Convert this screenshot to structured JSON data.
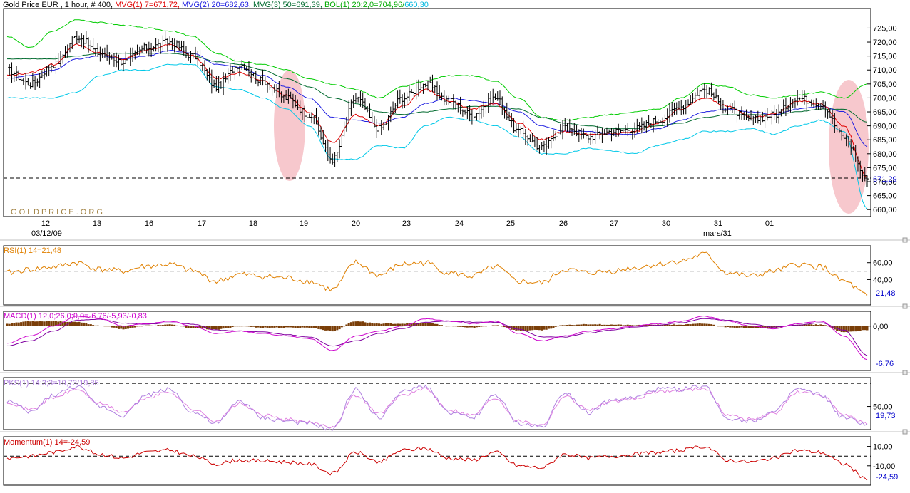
{
  "colors": {
    "frame": "#000000",
    "bar": "#000000",
    "mvg1": "#e00000",
    "mvg2": "#2020e0",
    "mvg3": "#006a2e",
    "bol_upper": "#00cc00",
    "bol_lower": "#00c8e8",
    "highlight": "#f4b0b8",
    "rsi": "#e08000",
    "macd_hist": "#7a3e08",
    "macd": "#cc00cc",
    "signal": "#8000a0",
    "stoch_k": "#b080e0",
    "stoch_d": "#e080e0",
    "momentum": "#cc0000",
    "last_value": "#0000cc",
    "watermark": "#a08040"
  },
  "main": {
    "legend": [
      {
        "text": "Gold Price EUR , 1 hour, # 400, ",
        "color": "#000000"
      },
      {
        "text": "MVG(1) 7=671,72, ",
        "color": "#e00000"
      },
      {
        "text": "MVG(2) 20=682,63, ",
        "color": "#2020e0"
      },
      {
        "text": "MVG(3) 50=691,39, ",
        "color": "#006a2e"
      },
      {
        "text": "BOL(1) 20;2,0=704,96/",
        "color": "#00aa00"
      },
      {
        "text": "660,30",
        "color": "#00b8e0"
      }
    ],
    "watermark": "G O L D P R I C E . O R G",
    "last_value_label": "671,29",
    "x_labels": [
      "12",
      "13",
      "16",
      "17",
      "18",
      "19",
      "20",
      "23",
      "24",
      "25",
      "26",
      "27",
      "30",
      "31",
      "01"
    ],
    "date_labels": [
      "03/12/09",
      "mars/31"
    ]
  },
  "rsi": {
    "legend": "RSI(1) 14=21,48",
    "value_label": "21,48"
  },
  "macd": {
    "legend": "MACD(1) 12,0;26,0;9,0=-6,76/-5,93/-0,83",
    "value_label": "-6,76"
  },
  "stoch": {
    "legend": "PKS(1) 14;3;3=19,73/19,85",
    "value_label": "19,73"
  },
  "momentum": {
    "legend": "Momentum(1) 14=-24,59",
    "value_label": "-24,59"
  },
  "chart_data": [
    {
      "type": "line",
      "subtype": "ohlc",
      "title": "Gold Price EUR , 1 hour, # 400",
      "categories": [
        "12",
        "13",
        "16",
        "17",
        "18",
        "19",
        "20",
        "23",
        "24",
        "25",
        "26",
        "27",
        "30",
        "31",
        "01"
      ],
      "y_ticks": [
        660,
        665,
        670,
        675,
        680,
        685,
        690,
        695,
        700,
        705,
        710,
        715,
        720,
        725
      ],
      "ylim": [
        657.5,
        732
      ],
      "reference_line": 671.29,
      "series": [
        {
          "name": "Price",
          "close": [
            710,
            705,
            712,
            722,
            716,
            713,
            718,
            720,
            715,
            704,
            712,
            706,
            700,
            694,
            678,
            700,
            689,
            700,
            705,
            699,
            694,
            700,
            688,
            682,
            690,
            686,
            688,
            689,
            692,
            697,
            703,
            696,
            692,
            694,
            700,
            698,
            686,
            671
          ]
        },
        {
          "name": "MVG(1) 7",
          "values": [
            708,
            709,
            712,
            719,
            716,
            714,
            717,
            719,
            715,
            707,
            709,
            706,
            701,
            695,
            684,
            694,
            690,
            697,
            703,
            699,
            696,
            698,
            691,
            685,
            688,
            687,
            687,
            688,
            691,
            696,
            700,
            697,
            693,
            694,
            699,
            698,
            690,
            671.72
          ]
        },
        {
          "name": "MVG(2) 20",
          "values": [
            707,
            708,
            710,
            714,
            715,
            714,
            715,
            717,
            716,
            712,
            711,
            708,
            704,
            700,
            693,
            692,
            691,
            693,
            698,
            700,
            699,
            698,
            695,
            690,
            688,
            688,
            687,
            687,
            689,
            692,
            695,
            696,
            695,
            694,
            696,
            697,
            695,
            682.63
          ]
        },
        {
          "name": "MVG(3) 50",
          "values": [
            714,
            714,
            714,
            715,
            716,
            716,
            716,
            716,
            715,
            713,
            712,
            710,
            707,
            704,
            700,
            698,
            695,
            694,
            695,
            696,
            697,
            697,
            696,
            693,
            691,
            690,
            689,
            689,
            690,
            691,
            693,
            694,
            694,
            694,
            695,
            696,
            696,
            691.39
          ]
        },
        {
          "name": "BOL(1) 20;2,0",
          "upper": [
            722,
            718,
            724,
            728,
            727,
            726,
            725,
            724,
            722,
            716,
            713,
            712,
            710,
            707,
            705,
            703,
            700,
            704,
            706,
            708,
            708,
            706,
            700,
            693,
            692,
            693,
            694,
            695,
            696,
            700,
            705,
            704,
            701,
            700,
            701,
            702,
            700,
            704.96
          ],
          "lower": [
            700,
            700,
            700,
            702,
            708,
            710,
            710,
            712,
            712,
            704,
            703,
            700,
            696,
            690,
            678,
            678,
            683,
            682,
            690,
            693,
            692,
            690,
            686,
            680,
            680,
            682,
            681,
            680,
            683,
            685,
            688,
            688,
            689,
            687,
            690,
            692,
            688,
            660.3
          ]
        }
      ]
    },
    {
      "type": "line",
      "title": "RSI(1) 14=21,48",
      "y_ticks": [
        40,
        60
      ],
      "ylim": [
        10,
        80
      ],
      "reference_line": 50,
      "series": [
        {
          "name": "RSI(1) 14",
          "values": [
            48,
            52,
            55,
            60,
            52,
            50,
            56,
            58,
            50,
            38,
            46,
            44,
            42,
            38,
            28,
            60,
            45,
            58,
            60,
            48,
            44,
            55,
            38,
            36,
            52,
            48,
            50,
            54,
            58,
            62,
            70,
            48,
            44,
            50,
            58,
            55,
            38,
            21.48
          ]
        }
      ]
    },
    {
      "type": "line",
      "title": "MACD(1) 12,0;26,0;9,0=-6,76/-5,93/-0,83",
      "y_ticks": [
        0
      ],
      "ylim": [
        -9,
        3
      ],
      "series": [
        {
          "name": "MACD",
          "values": [
            -3.5,
            -2,
            0,
            2,
            1.5,
            0,
            0.5,
            1,
            0,
            -1.5,
            -1,
            -1.5,
            -2,
            -2.5,
            -5,
            -2,
            -1,
            0,
            1.5,
            1,
            0.5,
            1,
            -1.5,
            -3,
            -2,
            -1,
            -0.5,
            0,
            0.5,
            1,
            2,
            1,
            0,
            -0.5,
            0.5,
            1,
            -2,
            -6.76
          ]
        },
        {
          "name": "Signal",
          "values": [
            -4,
            -3,
            -1,
            1.2,
            1.4,
            0.6,
            0.4,
            0.7,
            0.4,
            -0.8,
            -1,
            -1.2,
            -1.7,
            -2.2,
            -4,
            -3,
            -1.5,
            -0.5,
            0.8,
            1,
            0.8,
            0.8,
            -0.6,
            -2.2,
            -2.2,
            -1.4,
            -0.8,
            -0.2,
            0.2,
            0.7,
            1.5,
            1.2,
            0.4,
            -0.2,
            0.2,
            0.7,
            -0.8,
            -5.93
          ]
        },
        {
          "name": "Histogram",
          "values": [
            0.5,
            1,
            1,
            0.8,
            0.1,
            -0.6,
            0.1,
            0.3,
            -0.4,
            -0.7,
            0,
            -0.3,
            -0.3,
            -0.3,
            -1,
            1,
            0.5,
            0.5,
            0.7,
            0,
            -0.3,
            0.2,
            -0.9,
            -0.8,
            0.2,
            0.4,
            0.3,
            0.2,
            0.3,
            0.3,
            0.5,
            -0.2,
            -0.4,
            -0.3,
            0.3,
            0.3,
            -1.2,
            -0.83
          ]
        }
      ]
    },
    {
      "type": "line",
      "title": "PKS(1) 14;3;3=19,73/19,85",
      "y_ticks": [
        50
      ],
      "ylim": [
        10,
        100
      ],
      "reference_line": 90,
      "series": [
        {
          "name": "PKS %K",
          "values": [
            60,
            40,
            70,
            85,
            50,
            35,
            70,
            80,
            40,
            20,
            60,
            30,
            25,
            20,
            10,
            80,
            30,
            75,
            85,
            40,
            30,
            70,
            20,
            15,
            75,
            40,
            60,
            65,
            80,
            80,
            85,
            30,
            25,
            40,
            80,
            70,
            30,
            19.73
          ]
        },
        {
          "name": "PKS %D",
          "values": [
            58,
            45,
            65,
            80,
            55,
            40,
            65,
            75,
            45,
            25,
            55,
            35,
            28,
            22,
            15,
            70,
            38,
            70,
            80,
            45,
            35,
            65,
            25,
            18,
            68,
            45,
            58,
            63,
            76,
            78,
            82,
            35,
            28,
            38,
            75,
            70,
            35,
            19.85
          ]
        }
      ]
    },
    {
      "type": "line",
      "title": "Momentum(1) 14=-24,59",
      "y_ticks": [
        -10,
        10
      ],
      "ylim": [
        -30,
        20
      ],
      "reference_line": 0,
      "series": [
        {
          "name": "Momentum(1) 14",
          "values": [
            -2,
            0,
            4,
            10,
            2,
            -2,
            4,
            6,
            0,
            -8,
            -4,
            -5,
            -6,
            -8,
            -18,
            4,
            -6,
            6,
            8,
            -2,
            -4,
            4,
            -10,
            -12,
            2,
            -2,
            0,
            2,
            4,
            6,
            10,
            -4,
            -6,
            -2,
            6,
            4,
            -8,
            -24.59
          ]
        }
      ]
    }
  ]
}
